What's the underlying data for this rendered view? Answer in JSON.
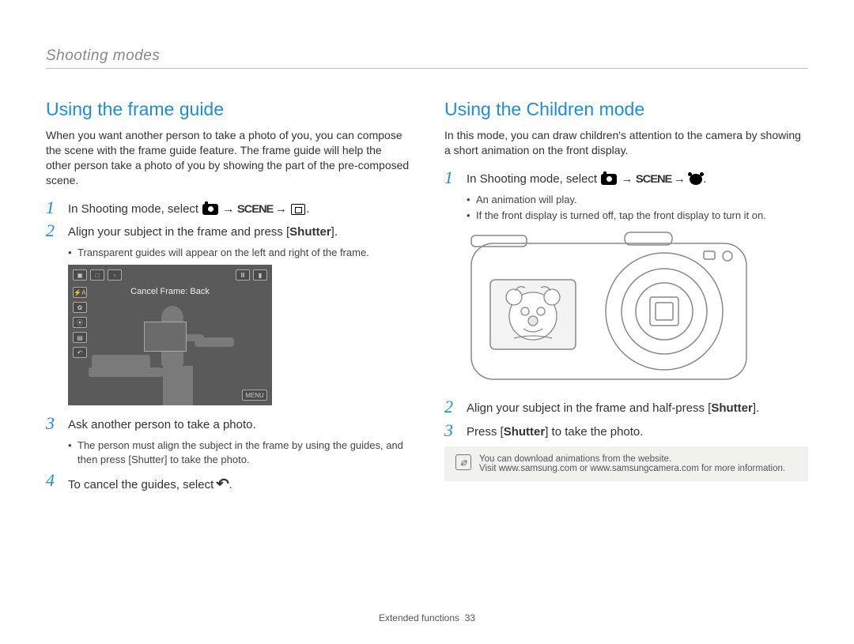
{
  "section": "Shooting modes",
  "left": {
    "title": "Using the frame guide",
    "intro": "When you want another person to take a photo of you, you can compose the scene with the frame guide feature. The frame guide will help the other person take a photo of you by showing the part of the pre-composed scene.",
    "steps": {
      "s1_pre": "In Shooting mode, select ",
      "s1_arrow": "→",
      "s1_scene": "SCENE",
      "s1_end": ".",
      "s2_pre": "Align your subject in the frame and press [",
      "s2_bold": "Shutter",
      "s2_post": "].",
      "s2_sub1": "Transparent guides will appear on the left and right of the frame.",
      "s3": "Ask another person to take a photo.",
      "s3_sub_pre": "The person must align the subject in the frame by using the guides, and then press [",
      "s3_sub_bold": "Shutter",
      "s3_sub_post": "] to take the photo.",
      "s4_pre": "To cancel the guides, select ",
      "s4_post": "."
    },
    "lcd": {
      "label": "Cancel Frame: Back",
      "menu": "MENU"
    }
  },
  "right": {
    "title": "Using the Children mode",
    "intro": "In this mode, you can draw children's attention to the camera by showing a short animation on the front display.",
    "steps": {
      "s1_pre": "In Shooting mode, select ",
      "s1_arrow": "→",
      "s1_scene": "SCENE",
      "s1_end": ".",
      "s1_sub1": "An animation will play.",
      "s1_sub2": "If the front display is turned off, tap the front display to turn it on.",
      "s2_pre": "Align your subject in the frame and half-press [",
      "s2_bold": "Shutter",
      "s2_post": "].",
      "s3_pre": "Press [",
      "s3_bold": "Shutter",
      "s3_post": "] to take the photo."
    },
    "note": {
      "line1": "You can download animations from the website.",
      "line2": "Visit www.samsung.com or www.samsungcamera.com for more information."
    }
  },
  "step_numbers": {
    "n1": "1",
    "n2": "2",
    "n3": "3",
    "n4": "4"
  },
  "footer": {
    "label": "Extended functions",
    "page": "33"
  }
}
